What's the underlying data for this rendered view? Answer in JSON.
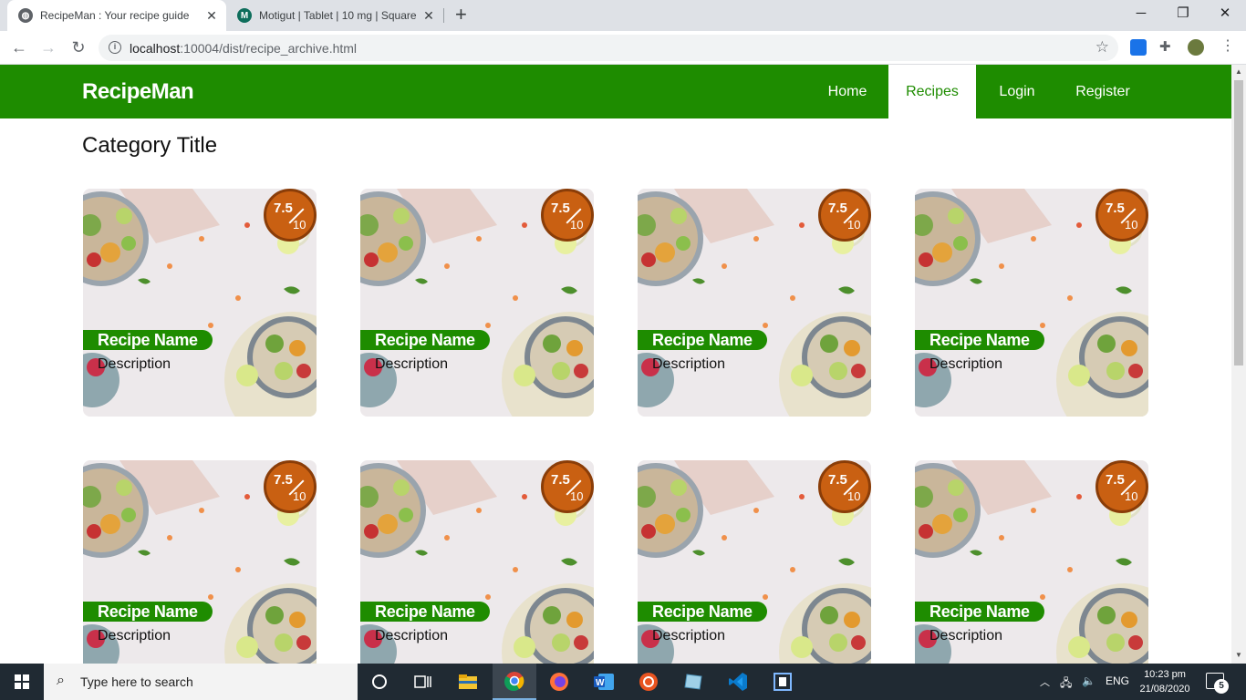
{
  "browser": {
    "tabs": [
      {
        "title": "RecipeMan : Your recipe guide",
        "active": true
      },
      {
        "title": "Motigut | Tablet | 10 mg | Square",
        "active": false
      }
    ],
    "url_host": "localhost",
    "url_path": ":10004/dist/recipe_archive.html"
  },
  "site": {
    "brand": "RecipeMan",
    "nav": [
      "Home",
      "Recipes",
      "Login",
      "Register"
    ],
    "active_nav": "Recipes",
    "accent": "#1e8c00",
    "rating_color": "#c96012"
  },
  "page": {
    "category_title": "Category Title"
  },
  "cards": [
    {
      "name": "Recipe Name",
      "description": "Description",
      "rating": "7.5",
      "rating_max": "10"
    },
    {
      "name": "Recipe Name",
      "description": "Description",
      "rating": "7.5",
      "rating_max": "10"
    },
    {
      "name": "Recipe Name",
      "description": "Description",
      "rating": "7.5",
      "rating_max": "10"
    },
    {
      "name": "Recipe Name",
      "description": "Description",
      "rating": "7.5",
      "rating_max": "10"
    },
    {
      "name": "Recipe Name",
      "description": "Description",
      "rating": "7.5",
      "rating_max": "10"
    },
    {
      "name": "Recipe Name",
      "description": "Description",
      "rating": "7.5",
      "rating_max": "10"
    },
    {
      "name": "Recipe Name",
      "description": "Description",
      "rating": "7.5",
      "rating_max": "10"
    },
    {
      "name": "Recipe Name",
      "description": "Description",
      "rating": "7.5",
      "rating_max": "10"
    }
  ],
  "taskbar": {
    "search_placeholder": "Type here to search",
    "language": "ENG",
    "time": "10:23 pm",
    "date": "21/08/2020",
    "notifications": "5"
  }
}
